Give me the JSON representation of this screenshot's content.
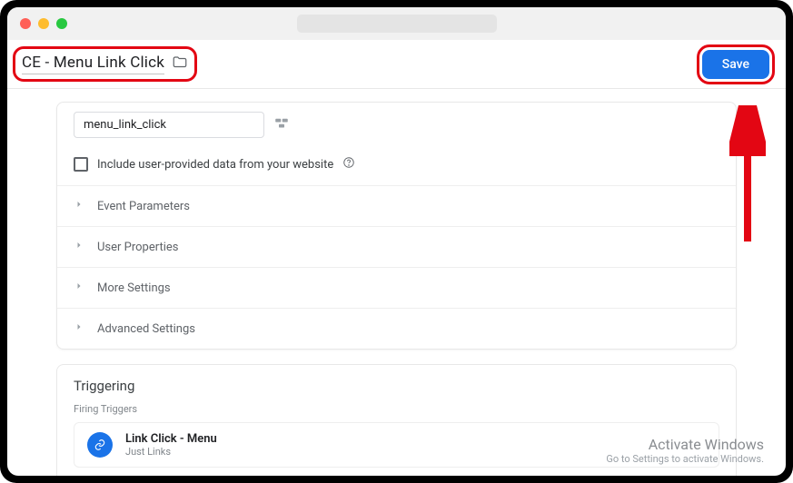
{
  "header": {
    "title": "CE - Menu Link Click",
    "save_label": "Save"
  },
  "config": {
    "event_name_value": "menu_link_click",
    "include_user_data_label": "Include user-provided data from your website",
    "sections": [
      "Event Parameters",
      "User Properties",
      "More Settings",
      "Advanced Settings"
    ]
  },
  "triggering": {
    "heading": "Triggering",
    "subheading": "Firing Triggers",
    "trigger": {
      "name": "Link Click - Menu",
      "type": "Just Links"
    }
  },
  "watermark": {
    "line1": "Activate Windows",
    "line2": "Go to Settings to activate Windows."
  }
}
